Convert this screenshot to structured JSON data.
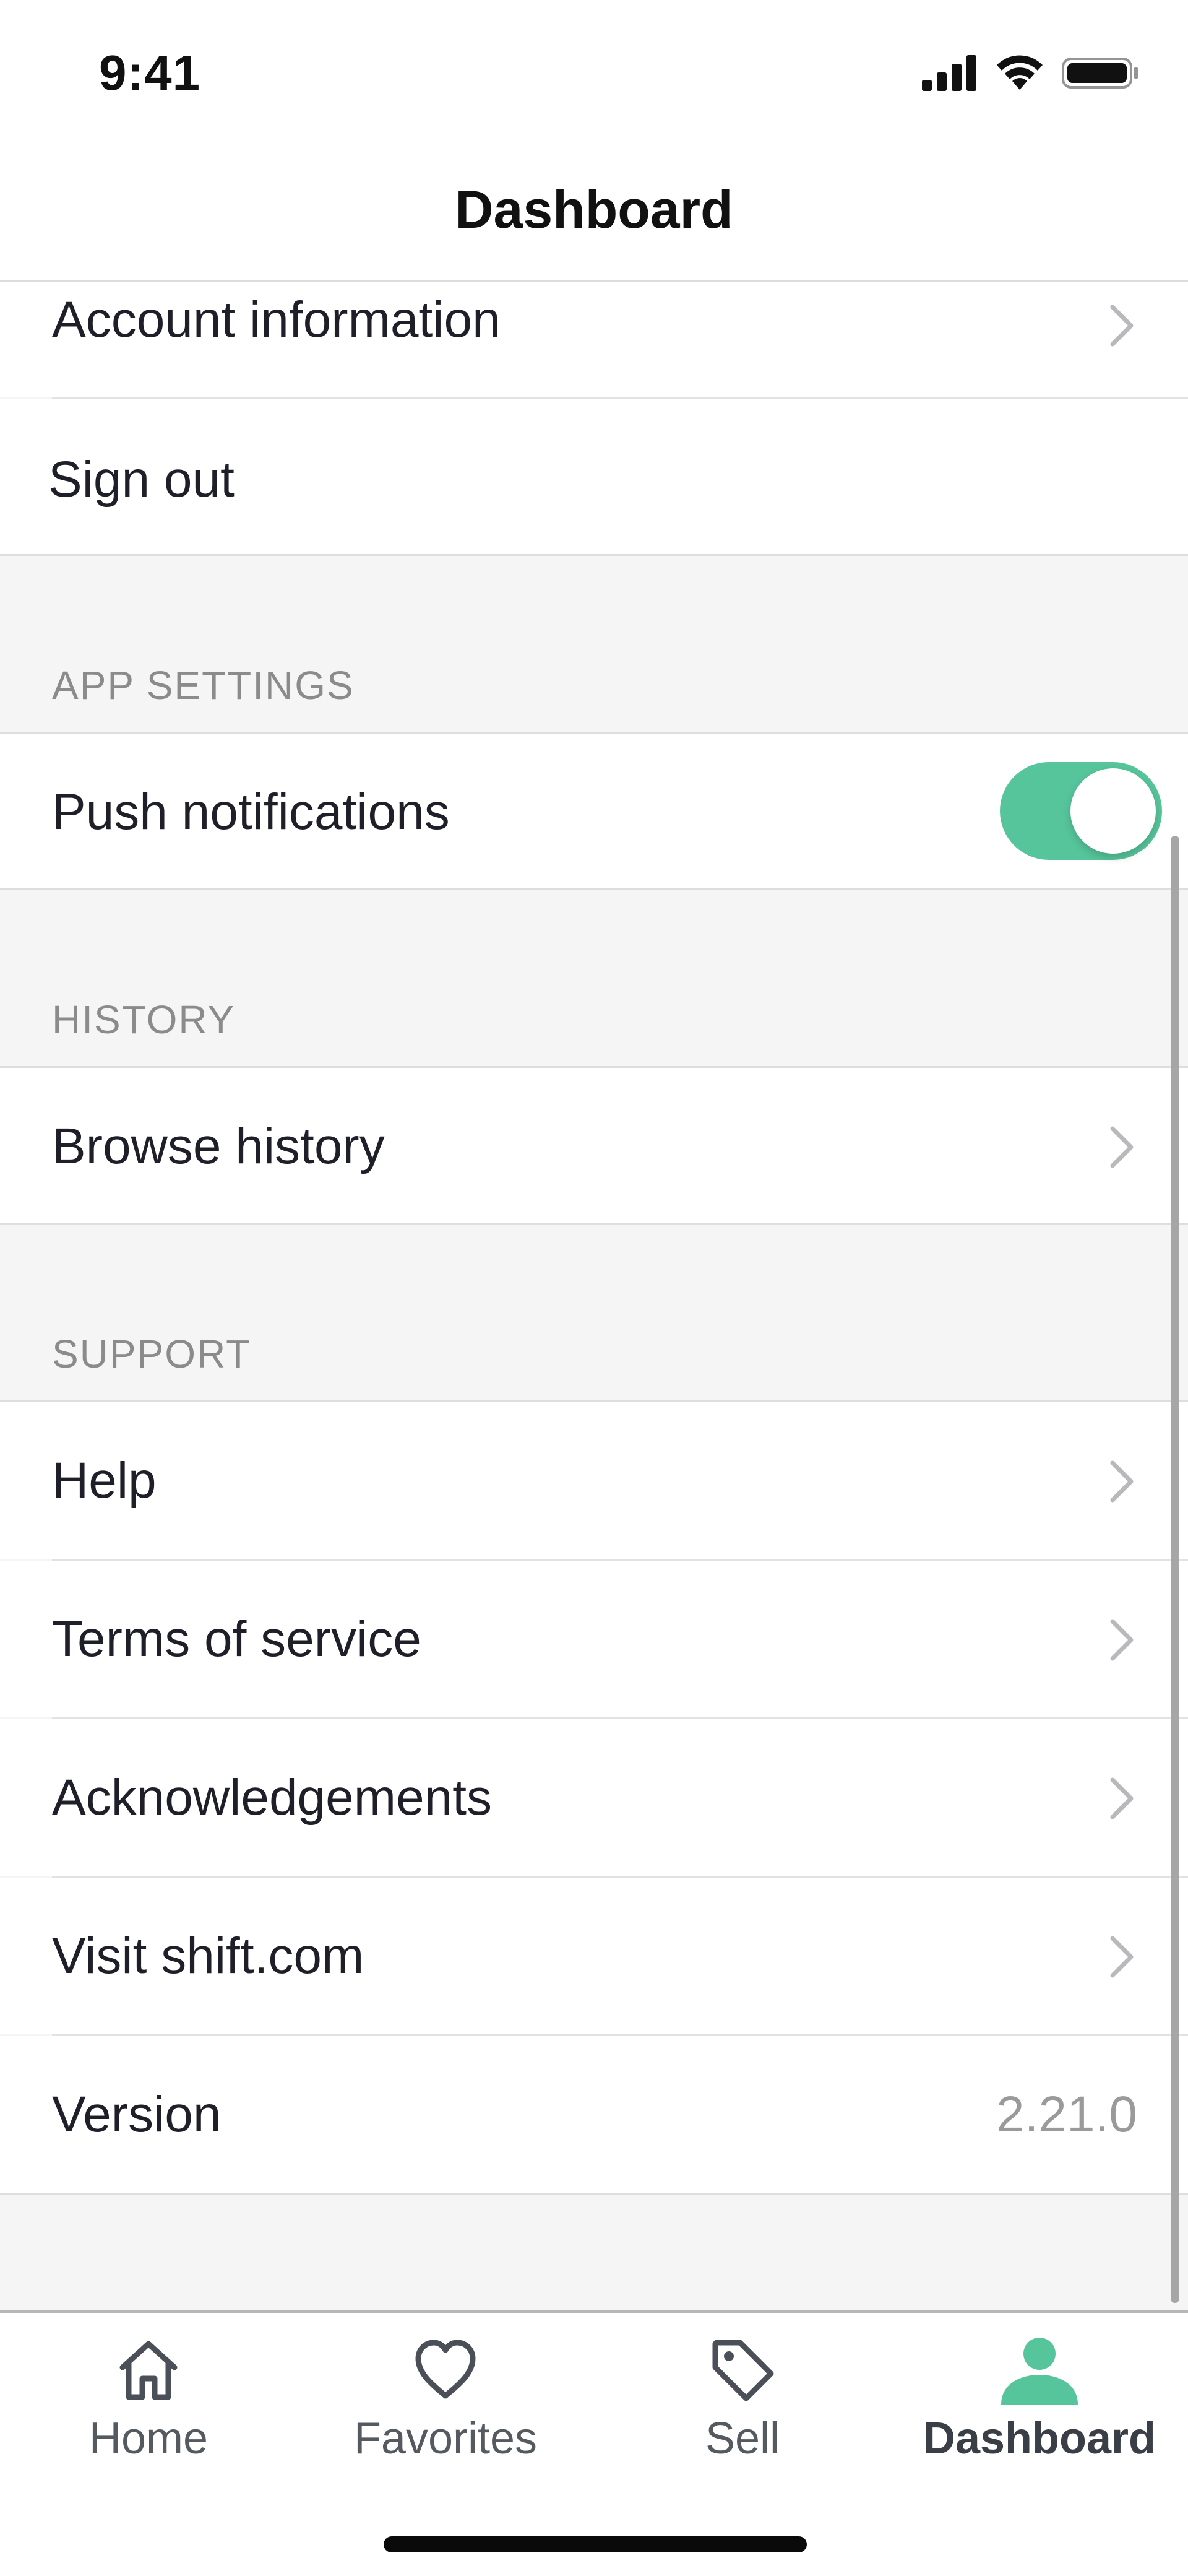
{
  "status_bar": {
    "time": "9:41",
    "icons": [
      "cellular-signal-icon",
      "wifi-icon",
      "battery-icon"
    ]
  },
  "nav": {
    "title": "Dashboard"
  },
  "account_section": {
    "items": [
      {
        "label": "Account information",
        "icon": "chevron-right-icon"
      },
      {
        "label": "Sign out"
      }
    ]
  },
  "app_settings_section": {
    "header": "APP SETTINGS",
    "push_notifications": {
      "label": "Push notifications",
      "enabled": true
    }
  },
  "history_section": {
    "header": "HISTORY",
    "items": [
      {
        "label": "Browse history",
        "icon": "chevron-right-icon"
      }
    ]
  },
  "support_section": {
    "header": "SUPPORT",
    "items": [
      {
        "label": "Help",
        "icon": "chevron-right-icon"
      },
      {
        "label": "Terms of service",
        "icon": "chevron-right-icon"
      },
      {
        "label": "Acknowledgements",
        "icon": "chevron-right-icon"
      },
      {
        "label": "Visit shift.com",
        "icon": "chevron-right-icon"
      }
    ],
    "version": {
      "label": "Version",
      "value": "2.21.0"
    }
  },
  "tab_bar": {
    "tabs": [
      {
        "label": "Home",
        "icon": "home-icon",
        "active": false
      },
      {
        "label": "Favorites",
        "icon": "heart-icon",
        "active": false
      },
      {
        "label": "Sell",
        "icon": "tag-icon",
        "active": false
      },
      {
        "label": "Dashboard",
        "icon": "person-icon",
        "active": true
      }
    ]
  },
  "colors": {
    "accent": "#57c59c",
    "background_grouped": "#f5f5f5",
    "section_header_text": "#8b8b8b",
    "secondary_value_text": "#9a9a9a"
  }
}
